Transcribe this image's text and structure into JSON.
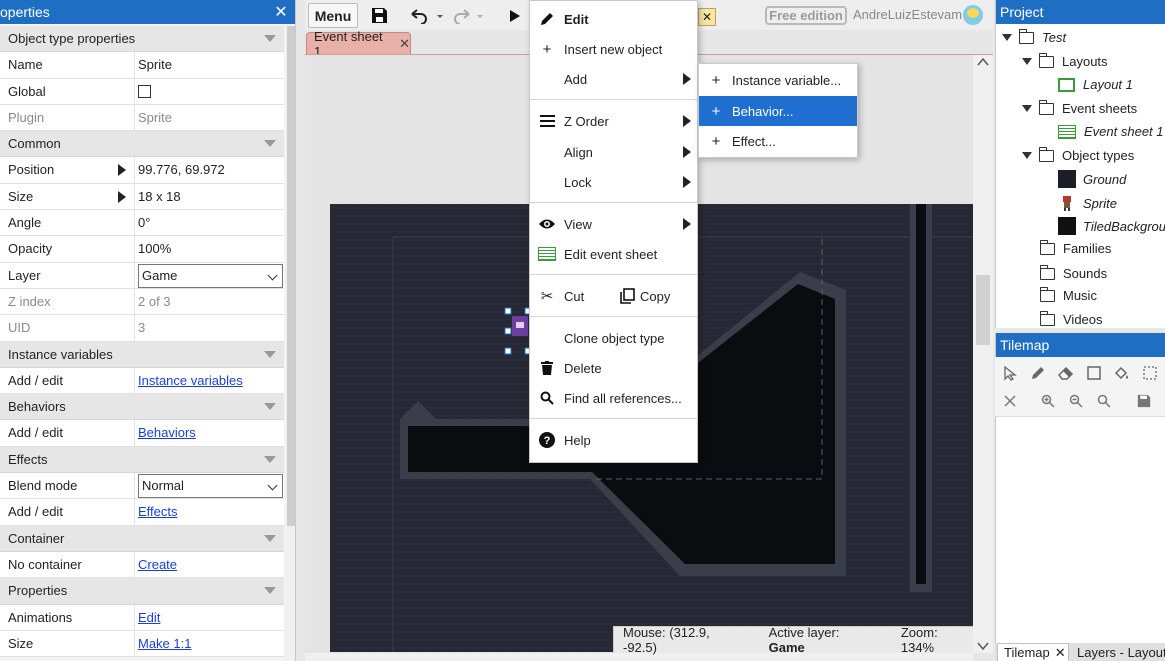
{
  "colors": {
    "accent": "#1e6fc4",
    "menu_highlight": "#1f6fd1",
    "tab_event": "#e8b0a6",
    "game_bg": "#22242f"
  },
  "properties": {
    "title": "operties",
    "close": "✕",
    "groups": {
      "object_type": "Object type properties",
      "common": "Common",
      "instance_vars": "Instance variables",
      "behaviors": "Behaviors",
      "effects": "Effects",
      "container": "Container",
      "properties": "Properties"
    },
    "rows": {
      "name": {
        "k": "Name",
        "v": "Sprite"
      },
      "global": {
        "k": "Global"
      },
      "plugin": {
        "k": "Plugin",
        "v": "Sprite"
      },
      "position": {
        "k": "Position",
        "v": "99.776, 69.972"
      },
      "size": {
        "k": "Size",
        "v": "18 x 18"
      },
      "angle": {
        "k": "Angle",
        "v": "0°"
      },
      "opacity": {
        "k": "Opacity",
        "v": "100%"
      },
      "layer": {
        "k": "Layer",
        "v": "Game"
      },
      "zindex": {
        "k": "Z index",
        "v": "2 of 3"
      },
      "uid": {
        "k": "UID",
        "v": "3"
      },
      "iv_add": {
        "k": "Add / edit",
        "v": "Instance variables"
      },
      "beh_add": {
        "k": "Add / edit",
        "v": "Behaviors"
      },
      "blend": {
        "k": "Blend mode",
        "v": "Normal"
      },
      "eff_add": {
        "k": "Add / edit",
        "v": "Effects"
      },
      "container": {
        "k": "No container",
        "v": "Create"
      },
      "animations": {
        "k": "Animations",
        "v": "Edit"
      },
      "psize": {
        "k": "Size",
        "v": "Make 1:1"
      }
    }
  },
  "toolbar": {
    "menu": "Menu",
    "edition": "Free edition",
    "user": "AndreLuizEstevam",
    "hidden_tab_close": "✕"
  },
  "tabs": {
    "event_sheet": "Event sheet 1",
    "close": "✕"
  },
  "status": {
    "mouse": "Mouse: (312.9, -92.5)",
    "active_layer_label": "Active layer:",
    "active_layer": "Game",
    "zoom": "Zoom: 134%"
  },
  "context_menu": {
    "edit": "Edit",
    "insert": "Insert new object",
    "add": "Add",
    "zorder": "Z Order",
    "align": "Align",
    "lock": "Lock",
    "view": "View",
    "edit_event_sheet": "Edit event sheet",
    "cut": "Cut",
    "copy": "Copy",
    "clone": "Clone object type",
    "delete": "Delete",
    "find": "Find all references...",
    "help": "Help"
  },
  "submenu": {
    "instance_variable": "Instance variable...",
    "behavior": "Behavior...",
    "effect": "Effect..."
  },
  "project": {
    "title": "Project",
    "test": "Test",
    "layouts": "Layouts",
    "layout1": "Layout 1",
    "event_sheets": "Event sheets",
    "event_sheet1": "Event sheet 1",
    "object_types": "Object types",
    "ground": "Ground",
    "sprite": "Sprite",
    "tiled": "TiledBackground",
    "families": "Families",
    "sounds": "Sounds",
    "music": "Music",
    "videos": "Videos"
  },
  "tilemap": {
    "title": "Tilemap",
    "tab1": "Tilemap",
    "tab1_close": "✕",
    "tab2": "Layers - Layout"
  }
}
